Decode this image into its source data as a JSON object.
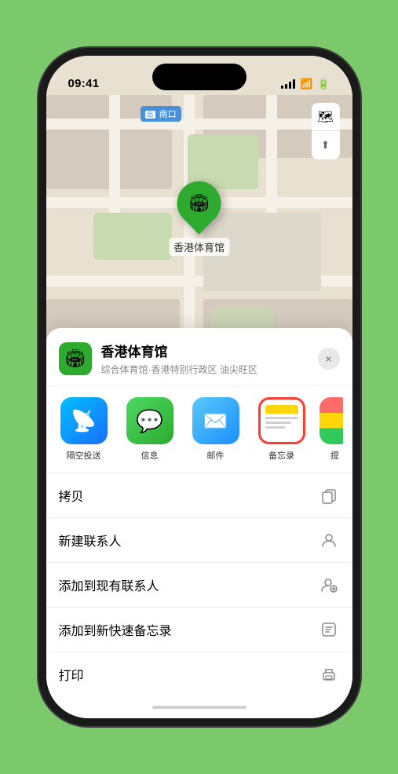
{
  "phone": {
    "status_bar": {
      "time": "09:41",
      "signal_label": "signal",
      "wifi_label": "wifi",
      "battery_label": "battery"
    },
    "map": {
      "label": "南口",
      "marker_name": "香港体育馆",
      "controls": {
        "map_icon": "🗺",
        "location_icon": "↗"
      }
    },
    "bottom_sheet": {
      "venue_icon": "🏟",
      "venue_name": "香港体育馆",
      "venue_subtitle": "综合体育馆·香港特别行政区 油尖旺区",
      "close_label": "×",
      "share_items": [
        {
          "id": "airdrop",
          "label": "隔空投送",
          "icon": "📡",
          "selected": false
        },
        {
          "id": "message",
          "label": "信息",
          "icon": "💬",
          "selected": false
        },
        {
          "id": "mail",
          "label": "邮件",
          "icon": "✉",
          "selected": false
        },
        {
          "id": "notes",
          "label": "备忘录",
          "icon": "notes",
          "selected": true
        },
        {
          "id": "more",
          "label": "提",
          "icon": "more",
          "selected": false
        }
      ],
      "actions": [
        {
          "id": "copy",
          "label": "拷贝",
          "icon": "copy"
        },
        {
          "id": "new-contact",
          "label": "新建联系人",
          "icon": "person"
        },
        {
          "id": "add-contact",
          "label": "添加到现有联系人",
          "icon": "person-add"
        },
        {
          "id": "quick-note",
          "label": "添加到新快速备忘录",
          "icon": "note"
        },
        {
          "id": "print",
          "label": "打印",
          "icon": "print"
        }
      ]
    }
  }
}
